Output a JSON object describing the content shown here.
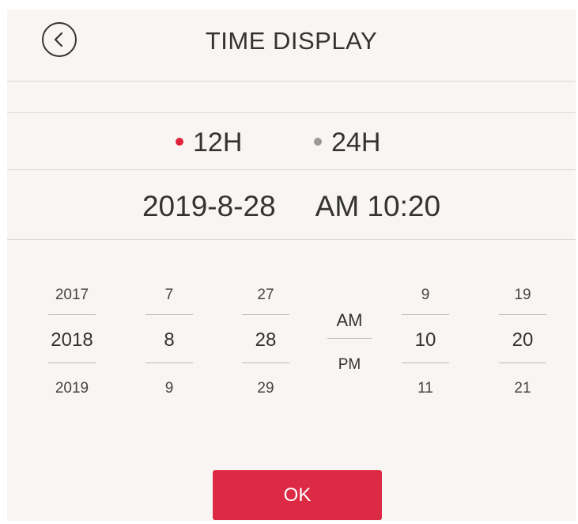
{
  "header": {
    "title": "TIME DISPLAY",
    "back_icon": "chevron-left-circle-icon"
  },
  "format": {
    "options": [
      {
        "label": "12H",
        "selected": true
      },
      {
        "label": "24H",
        "selected": false
      }
    ],
    "active_color": "#e0233c",
    "inactive_color": "#9a9a9a"
  },
  "current": {
    "date": "2019-8-28",
    "time": "AM 10:20"
  },
  "picker": {
    "year": {
      "prev": "2017",
      "selected": "2018",
      "next": "2019"
    },
    "month": {
      "prev": "7",
      "selected": "8",
      "next": "9"
    },
    "day": {
      "prev": "27",
      "selected": "28",
      "next": "29"
    },
    "period": {
      "am": "AM",
      "pm": "PM"
    },
    "hour": {
      "prev": "9",
      "selected": "10",
      "next": "11"
    },
    "minute": {
      "prev": "19",
      "selected": "20",
      "next": "21"
    }
  },
  "ok_button": {
    "label": "OK",
    "color": "#dd2a44"
  }
}
